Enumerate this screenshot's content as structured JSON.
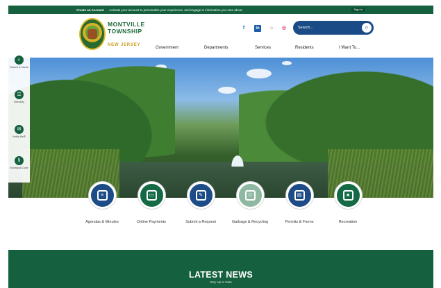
{
  "topbar": {
    "create_link": "Create an Account",
    "message": "- Activate your account to personalize your experience, and engage in information you care about.",
    "sign_in": "Sign In"
  },
  "logo": {
    "line1": "MONTVILLE",
    "line2": "TOWNSHIP",
    "state": "NEW JERSEY"
  },
  "social": [
    "facebook-icon",
    "linkedin-icon",
    "nextdoor-icon",
    "instagram-icon"
  ],
  "search": {
    "placeholder": "Search..."
  },
  "nav": [
    "Government",
    "Departments",
    "Services",
    "Residents",
    "I Want To..."
  ],
  "rail": [
    {
      "label": "Search & Name",
      "icon": "search-icon"
    },
    {
      "label": "Directory",
      "icon": "directory-icon"
    },
    {
      "label": "Notify Me®",
      "icon": "notify-icon"
    },
    {
      "label": "Municipal Code",
      "icon": "code-icon"
    }
  ],
  "quick_links": [
    {
      "label": "Agendas & Minutes",
      "color": "#1d4c86"
    },
    {
      "label": "Online Payments",
      "color": "#146a44"
    },
    {
      "label": "Submit a Request",
      "color": "#1d4c86"
    },
    {
      "label": "Garbage & Recycling",
      "color": "#8fb8a2"
    },
    {
      "label": "Permits & Forms",
      "color": "#1d4c86"
    },
    {
      "label": "Recreation",
      "color": "#146a44"
    }
  ],
  "news": {
    "title": "LATEST NEWS",
    "subtitle": "Stay Up to Date"
  },
  "colors": {
    "brand_green": "#14603f",
    "brand_blue": "#1d4c86",
    "gold": "#c59b17"
  }
}
